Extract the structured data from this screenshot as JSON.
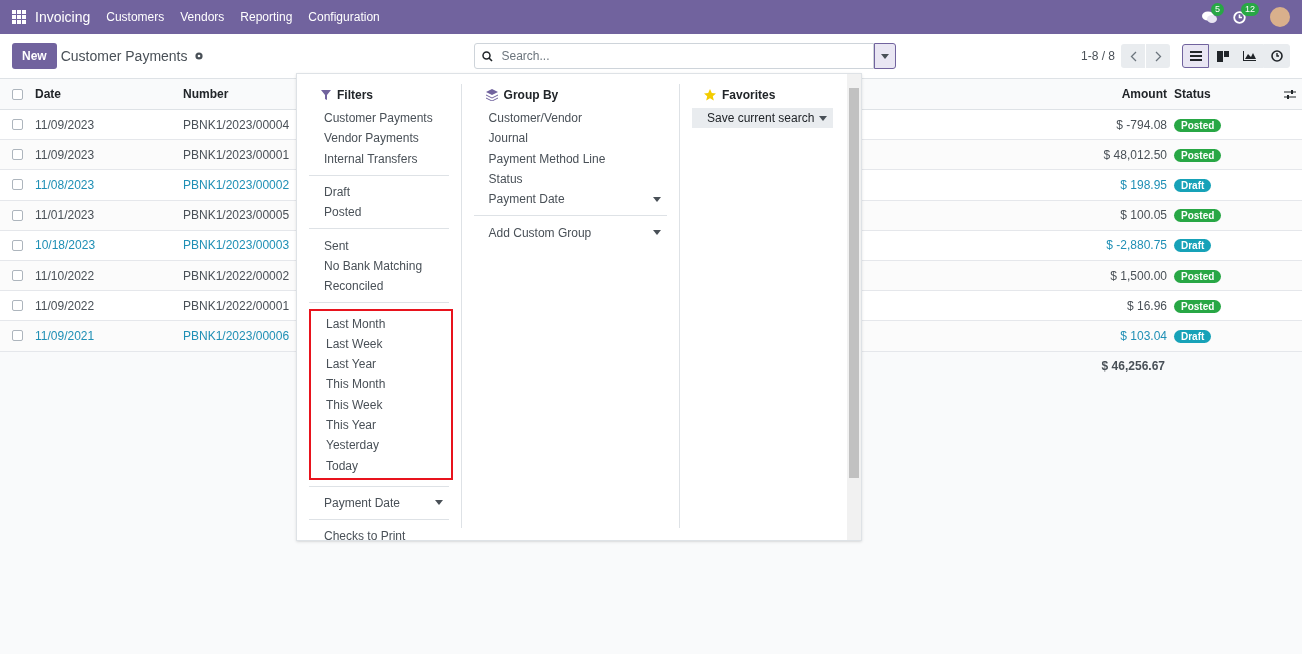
{
  "navbar": {
    "app": "Invoicing",
    "menu": [
      "Customers",
      "Vendors",
      "Reporting",
      "Configuration"
    ],
    "messages_badge": "5",
    "activities_badge": "12"
  },
  "control_panel": {
    "new_button": "New",
    "title": "Customer Payments",
    "search": {
      "placeholder": "Search..."
    },
    "pager": "1-8 / 8",
    "views": [
      {
        "kind": "list",
        "selected": true
      },
      {
        "kind": "kanban",
        "selected": false
      },
      {
        "kind": "graph",
        "selected": false
      },
      {
        "kind": "activity",
        "selected": false
      }
    ]
  },
  "table": {
    "columns": [
      "Date",
      "Number",
      "Amount",
      "Status"
    ],
    "select_all_checked": false,
    "rows": [
      {
        "date": "11/09/2023",
        "number": "PBNK1/2023/00004",
        "amount": "$ -794.08",
        "status": "Posted",
        "kind": "posted",
        "color": "#28a745",
        "checked": false
      },
      {
        "date": "11/09/2023",
        "number": "PBNK1/2023/00001",
        "amount": "$ 48,012.50",
        "status": "Posted",
        "kind": "posted",
        "color": "#28a745",
        "checked": false
      },
      {
        "date": "11/08/2023",
        "number": "PBNK1/2023/00002",
        "amount": "$ 198.95",
        "status": "Draft",
        "kind": "draft",
        "color": "#17a2b8",
        "checked": false
      },
      {
        "date": "11/01/2023",
        "number": "PBNK1/2023/00005",
        "amount": "$ 100.05",
        "status": "Posted",
        "kind": "posted",
        "color": "#28a745",
        "checked": false
      },
      {
        "date": "10/18/2023",
        "number": "PBNK1/2023/00003",
        "amount": "$ -2,880.75",
        "status": "Draft",
        "kind": "draft",
        "color": "#17a2b8",
        "checked": false
      },
      {
        "date": "11/10/2022",
        "number": "PBNK1/2022/00002",
        "amount": "$ 1,500.00",
        "status": "Posted",
        "kind": "posted",
        "color": "#28a745",
        "checked": false
      },
      {
        "date": "11/09/2022",
        "number": "PBNK1/2022/00001",
        "amount": "$ 16.96",
        "status": "Posted",
        "kind": "posted",
        "color": "#28a745",
        "checked": false
      },
      {
        "date": "11/09/2021",
        "number": "PBNK1/2023/00006",
        "amount": "$ 103.04",
        "status": "Draft",
        "kind": "draft",
        "color": "#17a2b8",
        "checked": false
      }
    ],
    "total": "$ 46,256.67"
  },
  "search_panel": {
    "filters": {
      "title": "Filters",
      "groups": [
        {
          "highlighted": false,
          "items": [
            {
              "label": "Customer Payments",
              "kind": "option"
            },
            {
              "label": "Vendor Payments",
              "kind": "option"
            },
            {
              "label": "Internal Transfers",
              "kind": "option"
            }
          ]
        },
        {
          "highlighted": false,
          "items": [
            {
              "label": "Draft",
              "kind": "option"
            },
            {
              "label": "Posted",
              "kind": "option"
            }
          ]
        },
        {
          "highlighted": false,
          "items": [
            {
              "label": "Sent",
              "kind": "option"
            },
            {
              "label": "No Bank Matching",
              "kind": "option"
            },
            {
              "label": "Reconciled",
              "kind": "option"
            }
          ]
        },
        {
          "highlighted": true,
          "items": [
            {
              "label": "Last Month",
              "kind": "option"
            },
            {
              "label": "Last Week",
              "kind": "option"
            },
            {
              "label": "Last Year",
              "kind": "option"
            },
            {
              "label": "This Month",
              "kind": "option"
            },
            {
              "label": "This Week",
              "kind": "option"
            },
            {
              "label": "This Year",
              "kind": "option"
            },
            {
              "label": "Yesterday",
              "kind": "option"
            },
            {
              "label": "Today",
              "kind": "option"
            }
          ]
        },
        {
          "highlighted": false,
          "items": [
            {
              "label": "Payment Date",
              "kind": "dropdown"
            }
          ]
        },
        {
          "highlighted": false,
          "items": [
            {
              "label": "Checks to Print",
              "kind": "option"
            }
          ]
        }
      ]
    },
    "group_by": {
      "title": "Group By",
      "groups": [
        {
          "items": [
            {
              "label": "Customer/Vendor",
              "kind": "option"
            },
            {
              "label": "Journal",
              "kind": "option"
            },
            {
              "label": "Payment Method Line",
              "kind": "option"
            },
            {
              "label": "Status",
              "kind": "option"
            },
            {
              "label": "Payment Date",
              "kind": "dropdown"
            }
          ]
        },
        {
          "items": [
            {
              "label": "Add Custom Group",
              "kind": "dropdown"
            }
          ]
        }
      ]
    },
    "favorites": {
      "title": "Favorites",
      "save_button": "Save current search"
    }
  }
}
